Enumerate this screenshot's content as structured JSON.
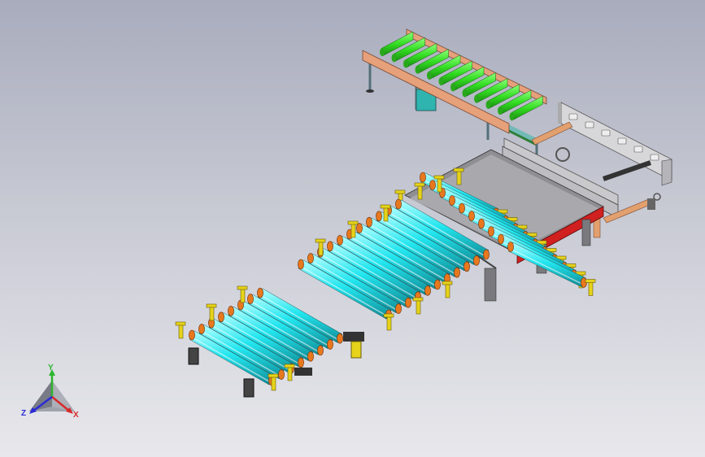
{
  "viewport": {
    "background_top": "#a9acbd",
    "background_bottom": "#e8e8ec"
  },
  "model": {
    "roller_colors": {
      "green": "#33dd22",
      "cyan": "#22e6ef",
      "orange": "#e8781e",
      "yellow": "#e6d31a",
      "frame_red": "#d02020",
      "frame_pink": "#e6a07a",
      "frame_grey": "#9a9aa0"
    }
  },
  "triad": {
    "y_label": "Y",
    "z_label": "Z",
    "x_label": "X",
    "y_color": "#2db52d",
    "z_color": "#2b2bd6",
    "x_color": "#d62b2b"
  }
}
